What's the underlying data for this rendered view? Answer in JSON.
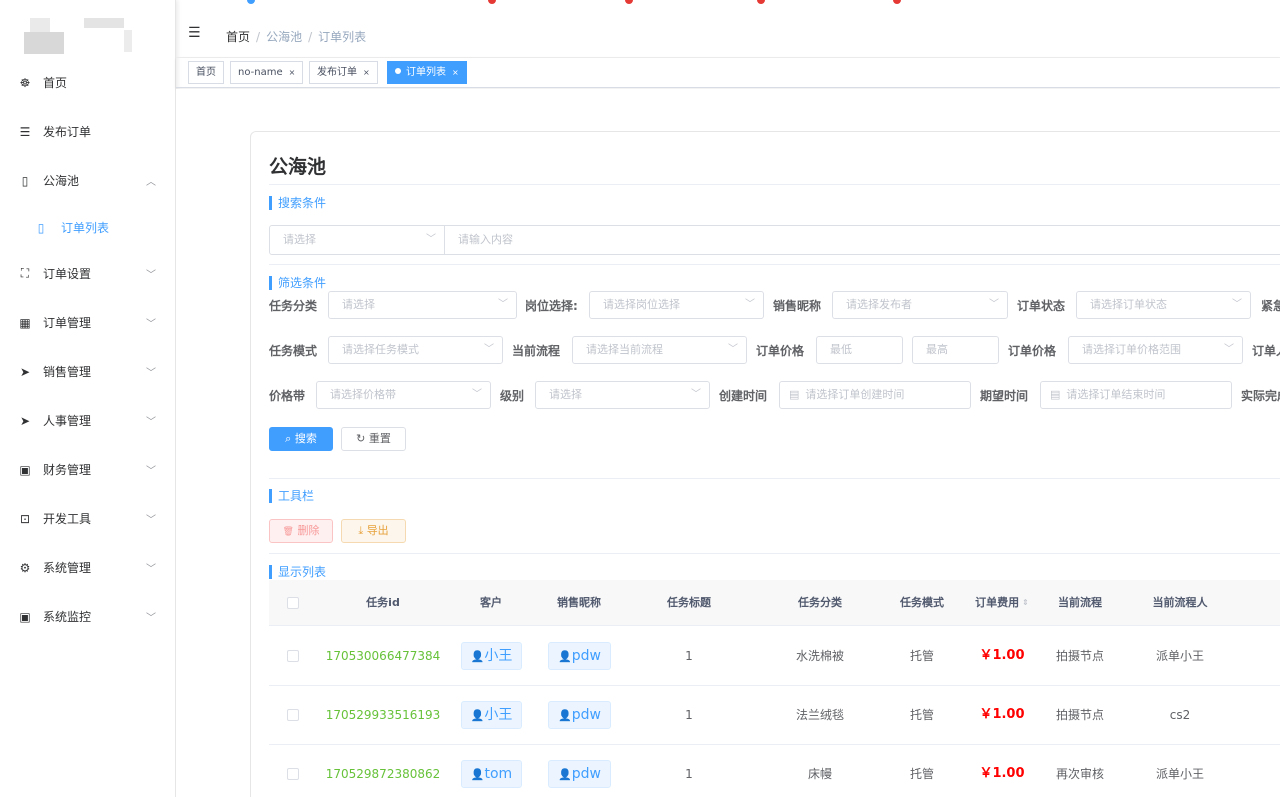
{
  "sidebar": {
    "items": [
      {
        "icon": "dashboard-icon",
        "glyph": "☸",
        "label": "首页",
        "arrow": ""
      },
      {
        "icon": "list-icon",
        "glyph": "☰",
        "label": "发布订单",
        "arrow": ""
      },
      {
        "icon": "book-icon",
        "glyph": "▯",
        "label": "公海池",
        "arrow": "︿"
      },
      {
        "icon": "book-icon",
        "glyph": "▯",
        "label": "订单列表",
        "arrow": ""
      },
      {
        "icon": "fullscreen-icon",
        "glyph": "⛶",
        "label": "订单设置",
        "arrow": "﹀"
      },
      {
        "icon": "table-icon",
        "glyph": "▦",
        "label": "订单管理",
        "arrow": "﹀"
      },
      {
        "icon": "send-icon",
        "glyph": "➤",
        "label": "销售管理",
        "arrow": "﹀"
      },
      {
        "icon": "send-icon",
        "glyph": "➤",
        "label": "人事管理",
        "arrow": "﹀"
      },
      {
        "icon": "monitor-icon",
        "glyph": "▣",
        "label": "财务管理",
        "arrow": "﹀"
      },
      {
        "icon": "toolbox-icon",
        "glyph": "⊡",
        "label": "开发工具",
        "arrow": "﹀"
      },
      {
        "icon": "gear-icon",
        "glyph": "⚙",
        "label": "系统管理",
        "arrow": "﹀"
      },
      {
        "icon": "monitor-icon",
        "glyph": "▣",
        "label": "系统监控",
        "arrow": "﹀"
      }
    ]
  },
  "header": {
    "menu_glyph": "☰",
    "breadcrumb": [
      "首页",
      "公海池",
      "订单列表"
    ],
    "separator": "/"
  },
  "tags": [
    {
      "label": "首页",
      "closable": false,
      "active": false
    },
    {
      "label": "no-name",
      "closable": true,
      "active": false
    },
    {
      "label": "发布订单",
      "closable": true,
      "active": false
    },
    {
      "label": "订单列表",
      "closable": true,
      "active": true
    }
  ],
  "tag_close": "×",
  "page": {
    "title": "公海池",
    "search_section": "搜索条件",
    "search_select_placeholder": "请选择",
    "search_input_placeholder": "请输入内容",
    "filter_section": "筛选条件",
    "toolbar_section": "工具栏",
    "list_section": "显示列表"
  },
  "filters": {
    "row1": [
      {
        "label": "任务分类",
        "placeholder": "请选择"
      },
      {
        "label": "岗位选择:",
        "placeholder": "请选择岗位选择"
      },
      {
        "label": "销售昵称",
        "placeholder": "请选择发布者"
      },
      {
        "label": "订单状态",
        "placeholder": "请选择订单状态"
      },
      {
        "label": "紧急",
        "placeholder": ""
      }
    ],
    "row2": [
      {
        "label": "任务模式",
        "placeholder": "请选择任务模式"
      },
      {
        "label": "当前流程",
        "placeholder": "请选择当前流程"
      },
      {
        "label": "订单价格",
        "min_placeholder": "最低",
        "max_placeholder": "最高"
      },
      {
        "label": "订单价格",
        "placeholder": "请选择订单价格范围"
      },
      {
        "label": "订单人",
        "placeholder": ""
      }
    ],
    "row3": [
      {
        "label": "价格带",
        "placeholder": "请选择价格带"
      },
      {
        "label": "级别",
        "placeholder": "请选择"
      },
      {
        "label": "创建时间",
        "placeholder": "请选择订单创建时间"
      },
      {
        "label": "期望时间",
        "placeholder": "请选择订单结束时间"
      },
      {
        "label": "实际完成",
        "placeholder": ""
      }
    ]
  },
  "buttons": {
    "search": "搜索",
    "search_glyph": "⌕",
    "reset": "重置",
    "reset_glyph": "↻",
    "delete": "删除",
    "delete_glyph": "🗑",
    "export": "导出",
    "export_glyph": "⤓",
    "arrow_glyph": "﹀",
    "calendar_glyph": "▤"
  },
  "table": {
    "columns": [
      "任务id",
      "客户",
      "销售昵称",
      "任务标题",
      "任务分类",
      "任务模式",
      "订单费用",
      "当前流程",
      "当前流程人"
    ],
    "sort_glyph": "⇕",
    "user_glyph": "👤",
    "rows": [
      {
        "id": "170530066477384",
        "customer": "小王",
        "sales": "pdw",
        "title": "1",
        "category": "水洗棉被",
        "mode": "托管",
        "fee": "￥1.00",
        "flow": "拍摄节点",
        "flow_person": "派单小王"
      },
      {
        "id": "170529933516193",
        "customer": "小王",
        "sales": "pdw",
        "title": "1",
        "category": "法兰绒毯",
        "mode": "托管",
        "fee": "￥1.00",
        "flow": "拍摄节点",
        "flow_person": "cs2"
      },
      {
        "id": "170529872380862",
        "customer": "tom",
        "sales": "pdw",
        "title": "1",
        "category": "床幔",
        "mode": "托管",
        "fee": "￥1.00",
        "flow": "再次审核",
        "flow_person": "派单小王"
      }
    ]
  },
  "colors": {
    "accent": "#409eff",
    "id_green": "#67c23a",
    "price_red": "#ff0000"
  }
}
